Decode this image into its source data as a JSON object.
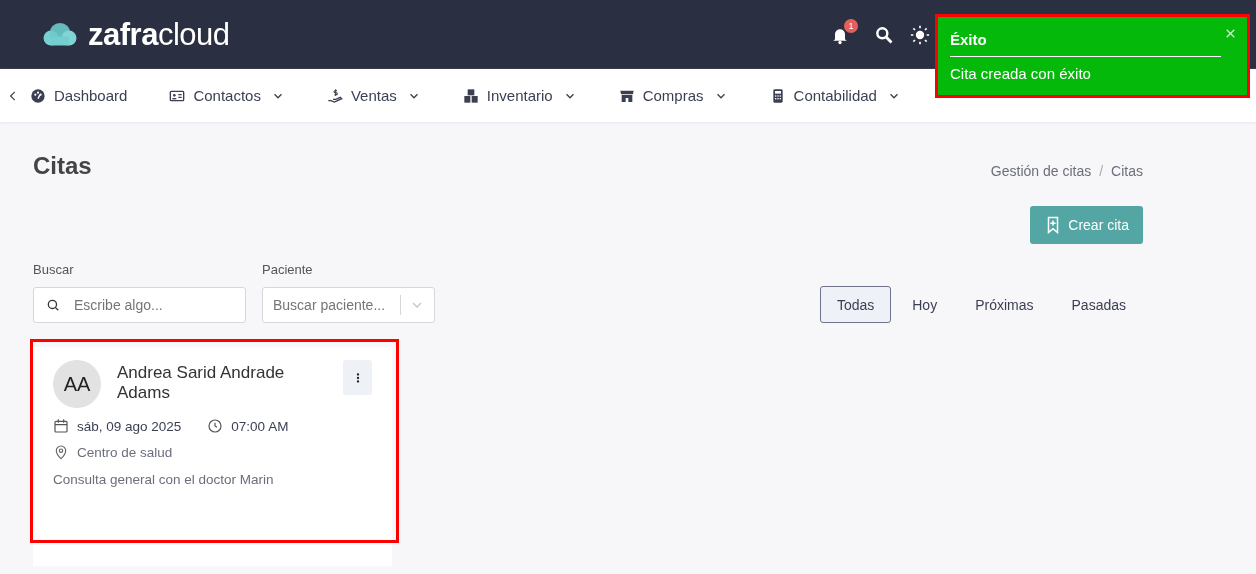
{
  "header": {
    "logo_bold": "zafra",
    "logo_light": "cloud",
    "notification_count": "1"
  },
  "nav": {
    "items": [
      {
        "label": "Dashboard",
        "has_menu": false
      },
      {
        "label": "Contactos",
        "has_menu": true
      },
      {
        "label": "Ventas",
        "has_menu": true
      },
      {
        "label": "Inventario",
        "has_menu": true
      },
      {
        "label": "Compras",
        "has_menu": true
      },
      {
        "label": "Contabilidad",
        "has_menu": true
      }
    ]
  },
  "page": {
    "title": "Citas",
    "breadcrumb": [
      "Gestión de citas",
      "Citas"
    ],
    "breadcrumb_separator": "/",
    "create_button": "Crear cita"
  },
  "filters": {
    "search": {
      "label": "Buscar",
      "placeholder": "Escribe algo..."
    },
    "patient": {
      "label": "Paciente",
      "placeholder": "Buscar paciente..."
    }
  },
  "tabs": [
    {
      "label": "Todas",
      "selected": true
    },
    {
      "label": "Hoy",
      "selected": false
    },
    {
      "label": "Próximas",
      "selected": false
    },
    {
      "label": "Pasadas",
      "selected": false
    }
  ],
  "appointments": [
    {
      "initials": "AA",
      "name": "Andrea Sarid Andrade Adams",
      "date": "sáb, 09 ago 2025",
      "time": "07:00 AM",
      "location": "Centro de salud",
      "description": "Consulta general con el doctor Marin",
      "highlighted": true
    }
  ],
  "toast": {
    "title": "Éxito",
    "message": "Cita creada con éxito",
    "highlighted": true
  }
}
